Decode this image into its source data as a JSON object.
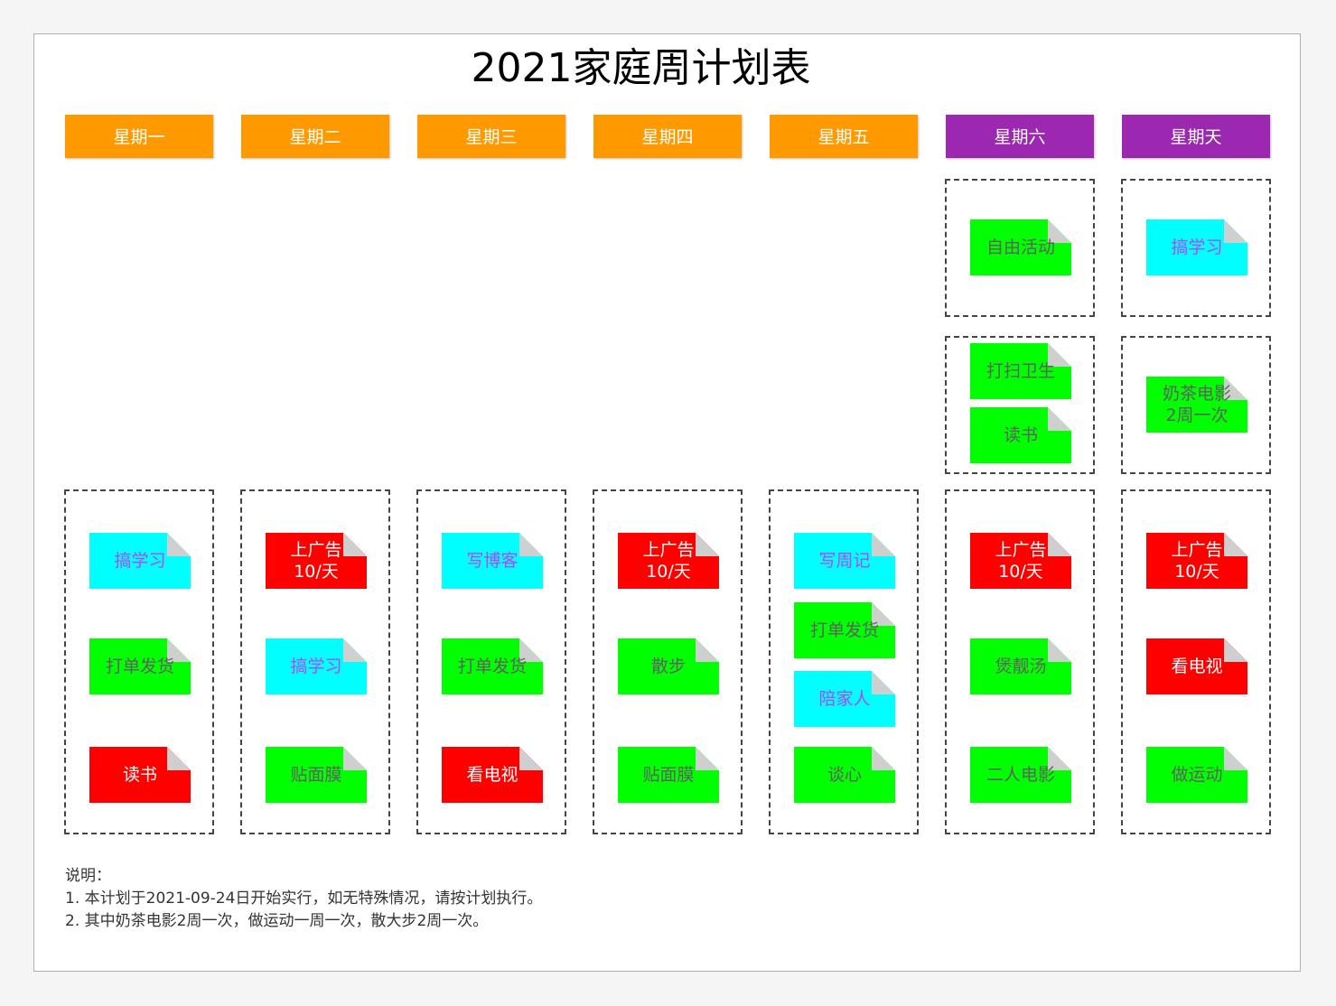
{
  "title": "2021家庭周计划表",
  "colors": {
    "weekday": "#ff9900",
    "weekend": "#9c27b0",
    "green": "#00ff00",
    "cyan": "#00ffff",
    "red": "#ff0000"
  },
  "days": [
    "星期一",
    "星期二",
    "星期三",
    "星期四",
    "星期五",
    "星期六",
    "星期天"
  ],
  "notes": {
    "mon": [
      "搞学习",
      "打单发货",
      "读书"
    ],
    "tue": [
      "上广告\n10/天",
      "搞学习",
      "贴面膜"
    ],
    "wed": [
      "写博客",
      "打单发货",
      "看电视"
    ],
    "thu": [
      "上广告\n10/天",
      "散步",
      "贴面膜"
    ],
    "fri": [
      "写周记",
      "打单发货",
      "陪家人",
      "谈心"
    ],
    "sat": [
      "自由活动",
      "打扫卫生",
      "读书",
      "上广告\n10/天",
      "煲靓汤",
      "二人电影"
    ],
    "sun": [
      "搞学习",
      "奶茶电影\n2周一次",
      "上广告\n10/天",
      "看电视",
      "做运动"
    ]
  },
  "footer": {
    "heading": "说明：",
    "line1": "1. 本计划于2021-09-24日开始实行，如无特殊情况，请按计划执行。",
    "line2": "2. 其中奶茶电影2周一次，做运动一周一次，散大步2周一次。"
  }
}
